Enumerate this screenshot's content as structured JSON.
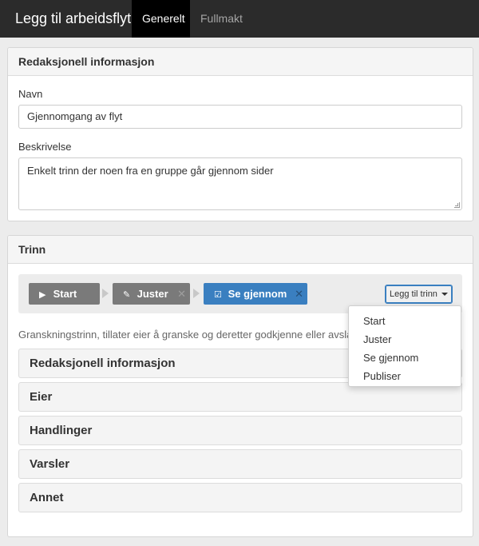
{
  "header": {
    "title": "Legg til arbeidsflyt",
    "tabs": [
      {
        "label": "Generelt",
        "active": true
      },
      {
        "label": "Fullmakt",
        "active": false
      }
    ]
  },
  "editorial": {
    "heading": "Redaksjonell informasjon",
    "name_label": "Navn",
    "name_value": "Gjennomgang av flyt",
    "description_label": "Beskrivelse",
    "description_value": "Enkelt trinn der noen fra en gruppe går gjennom sider"
  },
  "steps": {
    "heading": "Trinn",
    "items": [
      {
        "label": "Start",
        "icon": "play-icon",
        "removable": false,
        "active": false
      },
      {
        "label": "Juster",
        "icon": "edit-icon",
        "removable": true,
        "active": false
      },
      {
        "label": "Se gjennom",
        "icon": "check-square-icon",
        "removable": true,
        "active": true
      }
    ],
    "add_button_label": "Legg til trinn",
    "description": "Granskningstrinn, tillater eier å granske og deretter godkjenne eller avslå fly",
    "sections": [
      "Redaksjonell informasjon",
      "Eier",
      "Handlinger",
      "Varsler",
      "Annet"
    ],
    "dropdown_options": [
      "Start",
      "Juster",
      "Se gjennom",
      "Publiser"
    ],
    "remove_glyph": "✕"
  },
  "colors": {
    "topbar": "#2b2b2b",
    "active_tab": "#000000",
    "step_default": "#7a7a7a",
    "step_active": "#3a7fc0"
  }
}
